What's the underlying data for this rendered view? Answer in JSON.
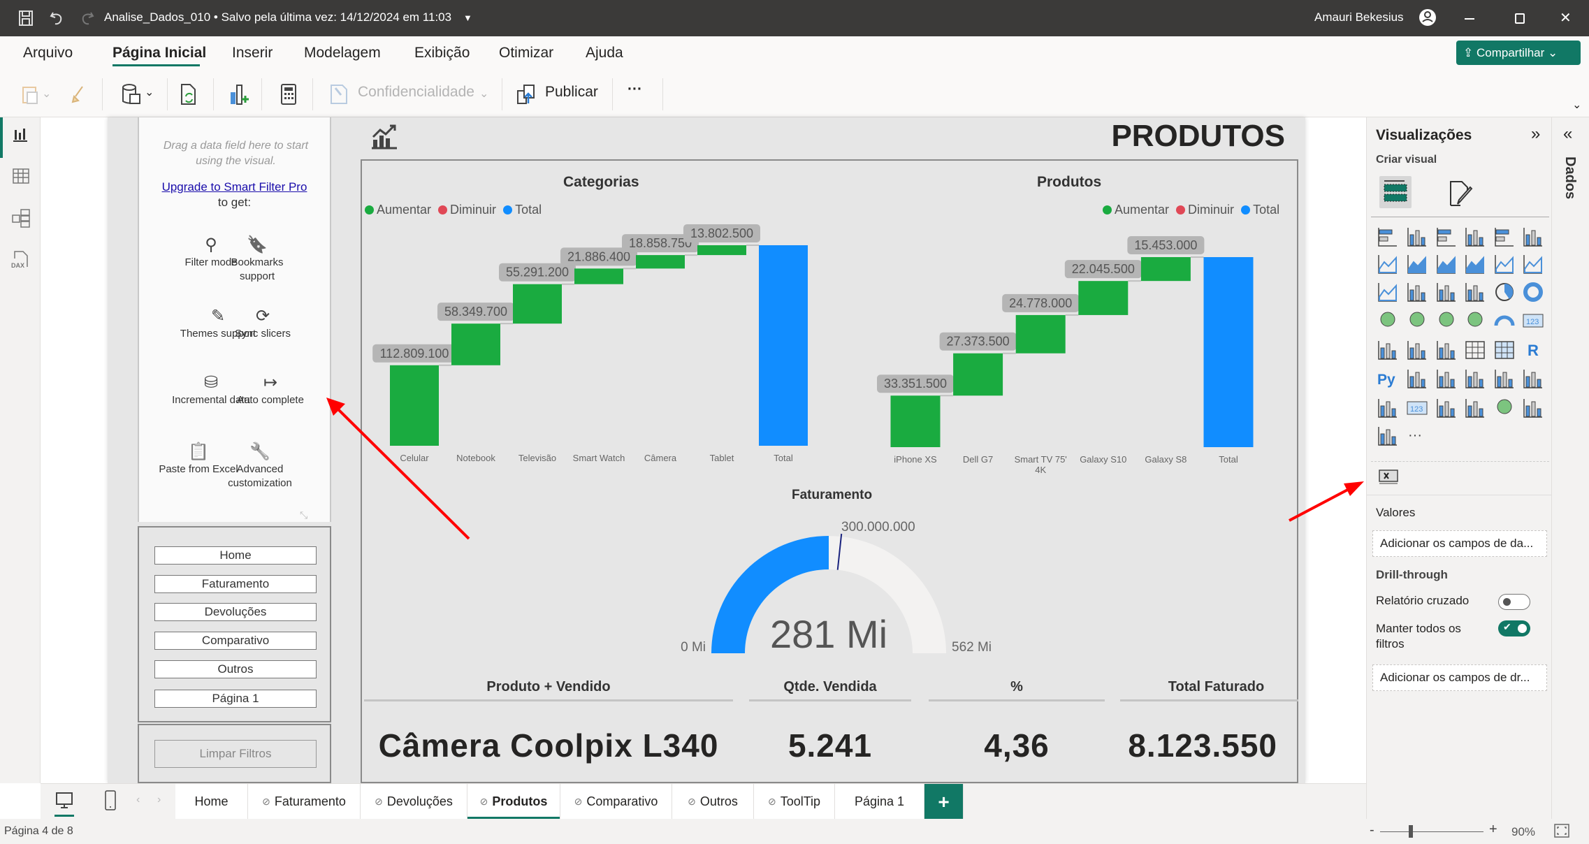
{
  "titlebar": {
    "file_title": "Analise_Dados_010 • Salvo pela última vez: 14/12/2024 em 11:03",
    "user_name": "Amauri Bekesius",
    "icons": [
      "save-icon",
      "undo-icon",
      "redo-icon",
      "dropdown-icon",
      "avatar-icon",
      "minimize-icon",
      "maximize-icon",
      "close-icon"
    ]
  },
  "menu": {
    "items": [
      "Arquivo",
      "Página Inicial",
      "Inserir",
      "Modelagem",
      "Exibição",
      "Otimizar",
      "Ajuda"
    ],
    "active": "Página Inicial",
    "share_label": "Compartilhar"
  },
  "toolbar": {
    "confidentiality_label": "Confidencialidade",
    "publish_label": "Publicar",
    "more_label": "···"
  },
  "left_nav": [
    "report-view",
    "table-view",
    "model-view",
    "dax-query-view"
  ],
  "slicer_visual": {
    "hint": "Drag a data field here to start using the visual.",
    "upgrade_link": "Upgrade to Smart Filter Pro",
    "to_get": "to get:",
    "features": [
      {
        "icon": "search-icon",
        "label": "Filter mode"
      },
      {
        "icon": "bookmark-icon",
        "label": "Bookmarks support"
      },
      {
        "icon": "brush-icon",
        "label": "Themes support"
      },
      {
        "icon": "sync-icon",
        "label": "Sync slicers"
      },
      {
        "icon": "database-icon",
        "label": "Incremental data"
      },
      {
        "icon": "arrow-right-icon",
        "label": "Auto complete"
      },
      {
        "icon": "paste-icon",
        "label": "Paste from Excel"
      },
      {
        "icon": "wrench-icon",
        "label": "Advanced customization"
      }
    ]
  },
  "nav_buttons": [
    "Home",
    "Faturamento",
    "Devoluções",
    "Comparativo",
    "Outros",
    "Página 1"
  ],
  "clear_filters_label": "Limpar Filtros",
  "report": {
    "page_title": "PRODUTOS",
    "gauge": {
      "title": "Faturamento",
      "value": 281,
      "value_label": "281 Mi",
      "min": 0,
      "min_label": "0 Mi",
      "max": 562,
      "max_label": "562 Mi",
      "target": 300,
      "target_label": "300.000.000",
      "value_color": "#118DFF",
      "track_color": "#F3F2F1"
    },
    "table": {
      "headers": [
        "Produto + Vendido",
        "Qtde. Vendida",
        "%",
        "Total Faturado"
      ],
      "values": [
        "Câmera Coolpix L340",
        "5.241",
        "4,36",
        "8.123.550"
      ]
    }
  },
  "chart_data": [
    {
      "type": "waterfall",
      "title": "Categorias",
      "legend": [
        {
          "label": "Aumentar",
          "color": "#1AAB40"
        },
        {
          "label": "Diminuir",
          "color": "#E04856"
        },
        {
          "label": "Total",
          "color": "#118DFF"
        }
      ],
      "legend_position": "top-left",
      "categories": [
        "Celular",
        "Notebook",
        "Televisão",
        "Smart Watch",
        "Câmera",
        "Tablet"
      ],
      "values": [
        112809100,
        58349700,
        55291200,
        21886400,
        18858750,
        13802500
      ],
      "data_labels": [
        "112.809.100",
        "58.349.700",
        "55.291.200",
        "21.886.400",
        "18.858.750",
        "13.802.500"
      ],
      "total_label": "Total",
      "grid": false
    },
    {
      "type": "waterfall",
      "title": "Produtos",
      "legend": [
        {
          "label": "Aumentar",
          "color": "#1AAB40"
        },
        {
          "label": "Diminuir",
          "color": "#E04856"
        },
        {
          "label": "Total",
          "color": "#118DFF"
        }
      ],
      "legend_position": "top-right",
      "categories": [
        "iPhone XS",
        "Dell G7",
        "Smart TV 75' 4K",
        "Galaxy S10",
        "Galaxy S8"
      ],
      "values": [
        33351500,
        27373500,
        24778000,
        22045500,
        15453000
      ],
      "data_labels": [
        "33.351.500",
        "27.373.500",
        "24.778.000",
        "22.045.500",
        "15.453.000"
      ],
      "total_label": "Total",
      "grid": false
    }
  ],
  "viz_pane": {
    "title": "Visualizações",
    "create_visual": "Criar visual",
    "visual_types": [
      "stacked-bar",
      "stacked-column",
      "clustered-bar",
      "clustered-column",
      "100-stacked-bar",
      "100-stacked-column",
      "line",
      "area",
      "stacked-area",
      "100-stacked-area",
      "line-stacked-column",
      "line-clustered-column",
      "ribbon",
      "waterfall",
      "funnel",
      "scatter",
      "pie",
      "donut",
      "treemap",
      "map",
      "filled-map",
      "azure-map",
      "gauge",
      "card",
      "multi-row-card",
      "kpi",
      "slicer",
      "table",
      "matrix",
      "r-script",
      "python",
      "key-influencers",
      "decomposition-tree",
      "qa",
      "smart-narrative",
      "metrics",
      "paginated-report",
      "card-new",
      "button-slicer",
      "text-slicer",
      "arcgis-map",
      "power-apps",
      "power-automate",
      "more"
    ],
    "values_label": "Valores",
    "values_placeholder": "Adicionar os campos de da...",
    "drillthrough_label": "Drill-through",
    "cross_report_label": "Relatório cruzado",
    "cross_report_on": false,
    "keep_filters_label": "Manter todos os filtros",
    "keep_filters_on": true,
    "drill_placeholder": "Adicionar os campos de dr..."
  },
  "data_pane_label": "Dados",
  "tabs": {
    "items": [
      {
        "label": "Home",
        "hidden": false
      },
      {
        "label": "Faturamento",
        "hidden": true
      },
      {
        "label": "Devoluções",
        "hidden": true
      },
      {
        "label": "Produtos",
        "hidden": true
      },
      {
        "label": "Comparativo",
        "hidden": true
      },
      {
        "label": "Outros",
        "hidden": true
      },
      {
        "label": "ToolTip",
        "hidden": true
      },
      {
        "label": "Página 1",
        "hidden": false
      }
    ],
    "active": "Produtos",
    "add_label": "+"
  },
  "status": {
    "page_info": "Página 4 de 8",
    "zoom": "90%",
    "zoom_level": 90,
    "zoom_minus": "-",
    "zoom_plus": "+"
  },
  "colors": {
    "accent": "#117865",
    "annotation_arrow": "#FF0000"
  }
}
